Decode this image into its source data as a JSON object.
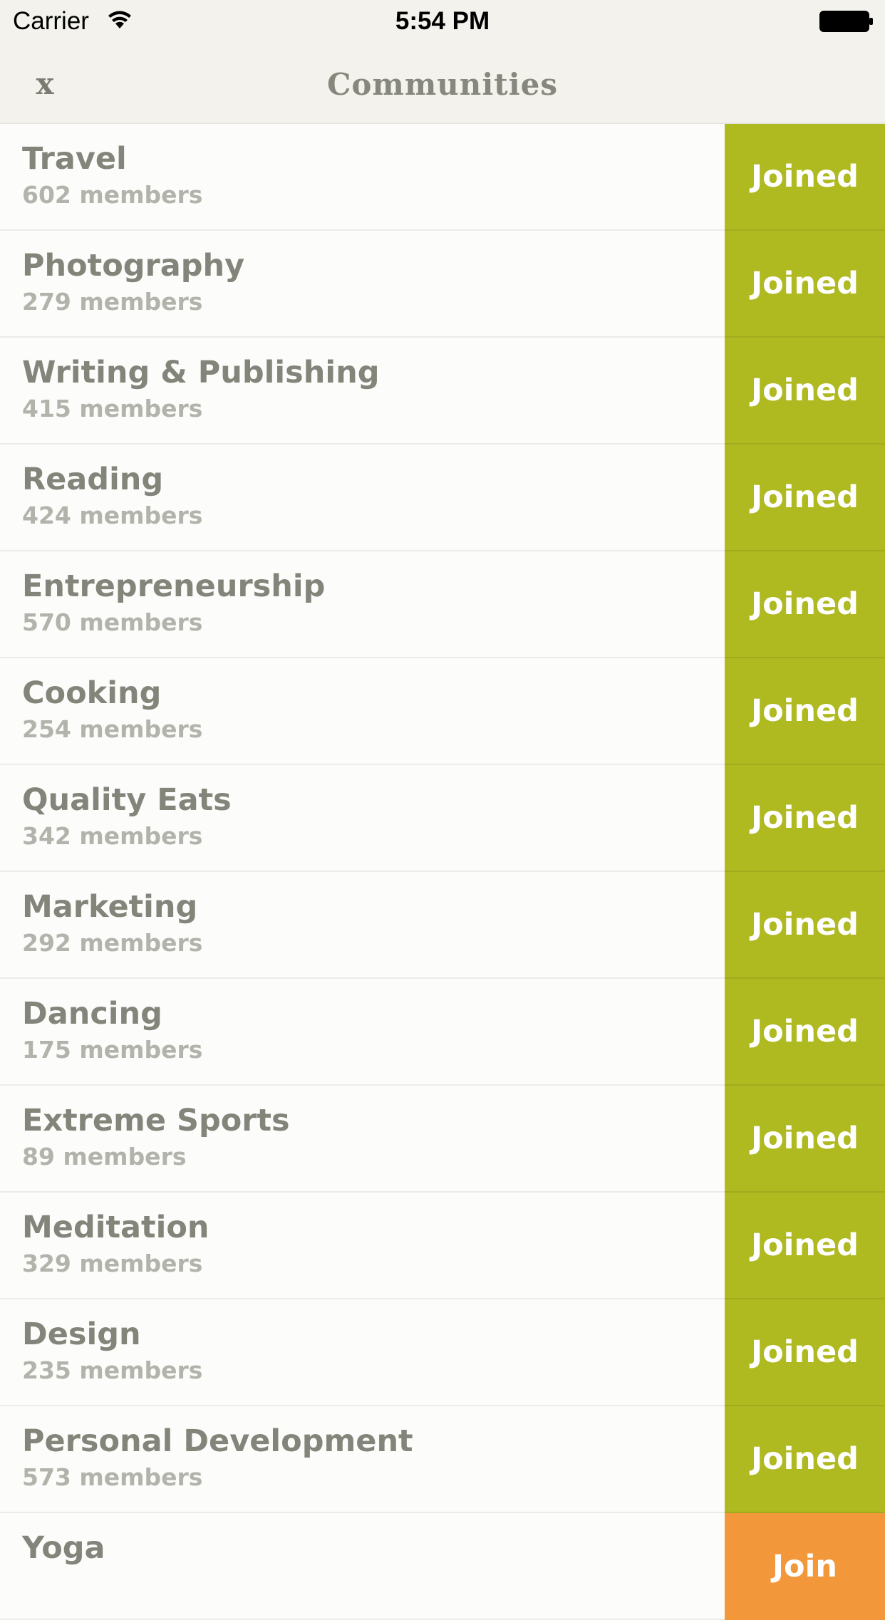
{
  "status_bar": {
    "carrier": "Carrier",
    "time": "5:54 PM"
  },
  "nav": {
    "close_label": "x",
    "title": "Communities"
  },
  "colors": {
    "joined": "#afb920",
    "join": "#f2973a"
  },
  "communities": [
    {
      "name": "Travel",
      "members": "602 members",
      "action": "Joined",
      "state": "joined"
    },
    {
      "name": "Photography",
      "members": "279 members",
      "action": "Joined",
      "state": "joined"
    },
    {
      "name": "Writing & Publishing",
      "members": "415 members",
      "action": "Joined",
      "state": "joined"
    },
    {
      "name": "Reading",
      "members": "424 members",
      "action": "Joined",
      "state": "joined"
    },
    {
      "name": "Entrepreneurship",
      "members": "570 members",
      "action": "Joined",
      "state": "joined"
    },
    {
      "name": "Cooking",
      "members": "254 members",
      "action": "Joined",
      "state": "joined"
    },
    {
      "name": "Quality Eats",
      "members": "342 members",
      "action": "Joined",
      "state": "joined"
    },
    {
      "name": "Marketing",
      "members": "292 members",
      "action": "Joined",
      "state": "joined"
    },
    {
      "name": "Dancing",
      "members": "175 members",
      "action": "Joined",
      "state": "joined"
    },
    {
      "name": "Extreme Sports",
      "members": "89 members",
      "action": "Joined",
      "state": "joined"
    },
    {
      "name": "Meditation",
      "members": "329 members",
      "action": "Joined",
      "state": "joined"
    },
    {
      "name": "Design",
      "members": "235 members",
      "action": "Joined",
      "state": "joined"
    },
    {
      "name": "Personal Development",
      "members": "573 members",
      "action": "Joined",
      "state": "joined"
    },
    {
      "name": "Yoga",
      "members": "",
      "action": "Join",
      "state": "join"
    }
  ]
}
